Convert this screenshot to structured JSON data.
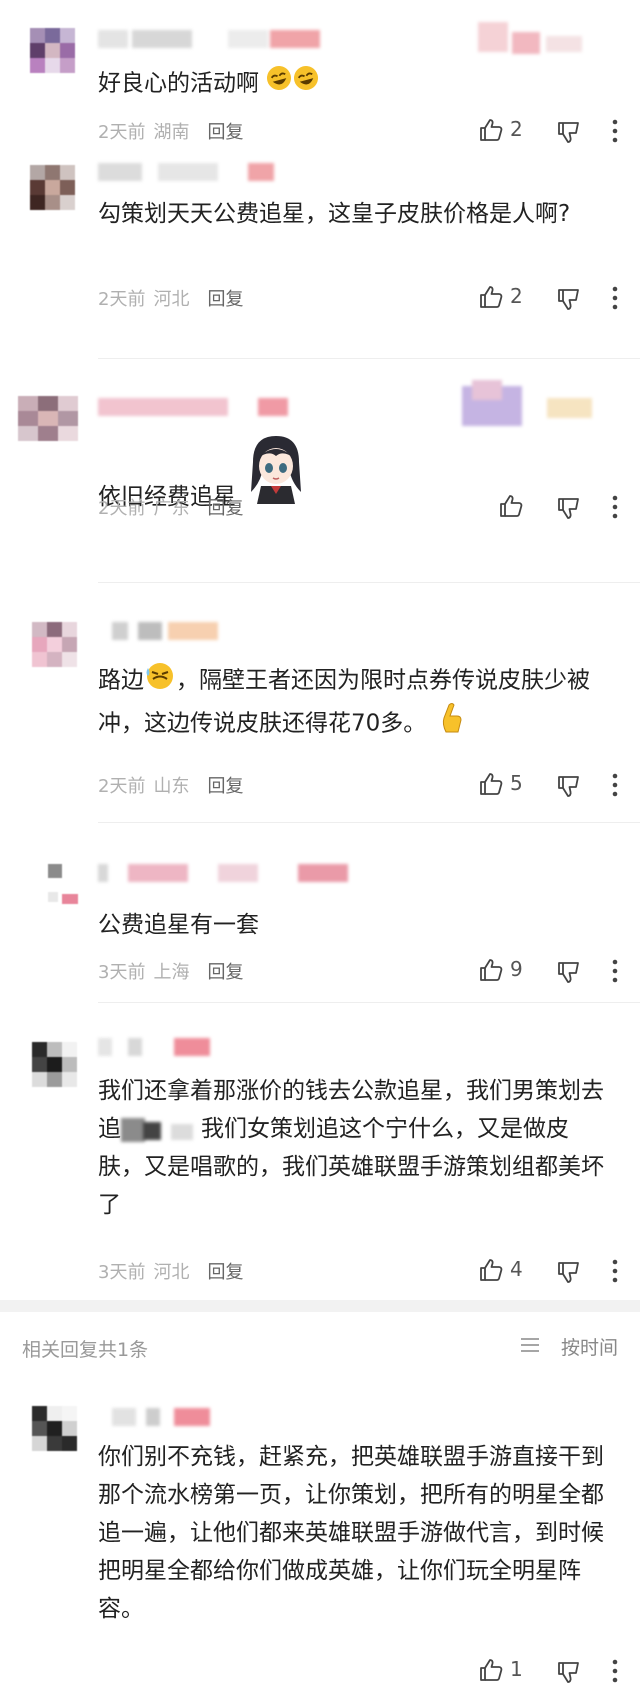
{
  "comments": [
    {
      "text": "好良心的活动啊",
      "time": "2天前",
      "location": "湖南",
      "reply_label": "回复",
      "likes": "2"
    },
    {
      "text": "勾策划天天公费追星，这皇子皮肤价格是人啊?",
      "time": "2天前",
      "location": "河北",
      "reply_label": "回复",
      "likes": "2"
    },
    {
      "text": "依旧经费追星",
      "time": "2天前",
      "location": "广东",
      "reply_label": "回复",
      "likes": ""
    },
    {
      "text_part1": "路边",
      "text_part2": "，隔壁王者还因为限时点券传说皮肤少被冲，这边传说皮肤还得花70多。",
      "time": "2天前",
      "location": "山东",
      "reply_label": "回复",
      "likes": "5"
    },
    {
      "text": "公费追星有一套",
      "time": "3天前",
      "location": "上海",
      "reply_label": "回复",
      "likes": "9"
    },
    {
      "text_part1": "我们还拿着那涨价的钱去公款追星，我们男策划去追",
      "text_part2": "我们女策划追这个宁什么，又是做皮肤，又是唱歌的，我们英雄联盟手游策划组都美坏了",
      "time": "3天前",
      "location": "河北",
      "reply_label": "回复",
      "likes": "4"
    }
  ],
  "related": {
    "count_label": "相关回复共1条",
    "sort_label": "按时间"
  },
  "reply": {
    "text": "你们别不充钱，赶紧充，把英雄联盟手游直接干到那个流水榜第一页，让你策划，把所有的明星全都追一遍，让他们都来英雄联盟手游做代言，到时候把明星全都给你们做成英雄，让你们玩全明星阵容。",
    "likes": "1"
  },
  "colors": {
    "text": "#222222",
    "meta": "#b0b0b0",
    "reply": "#666666",
    "divider": "#eeeeee"
  },
  "icons": [
    "thumbs-up-icon",
    "thumbs-down-icon",
    "more-vertical-icon",
    "sort-list-icon",
    "laughing-emoji-icon",
    "anime-girl-sticker-icon",
    "sweat-emoji-icon",
    "pointing-hand-emoji-icon"
  ]
}
